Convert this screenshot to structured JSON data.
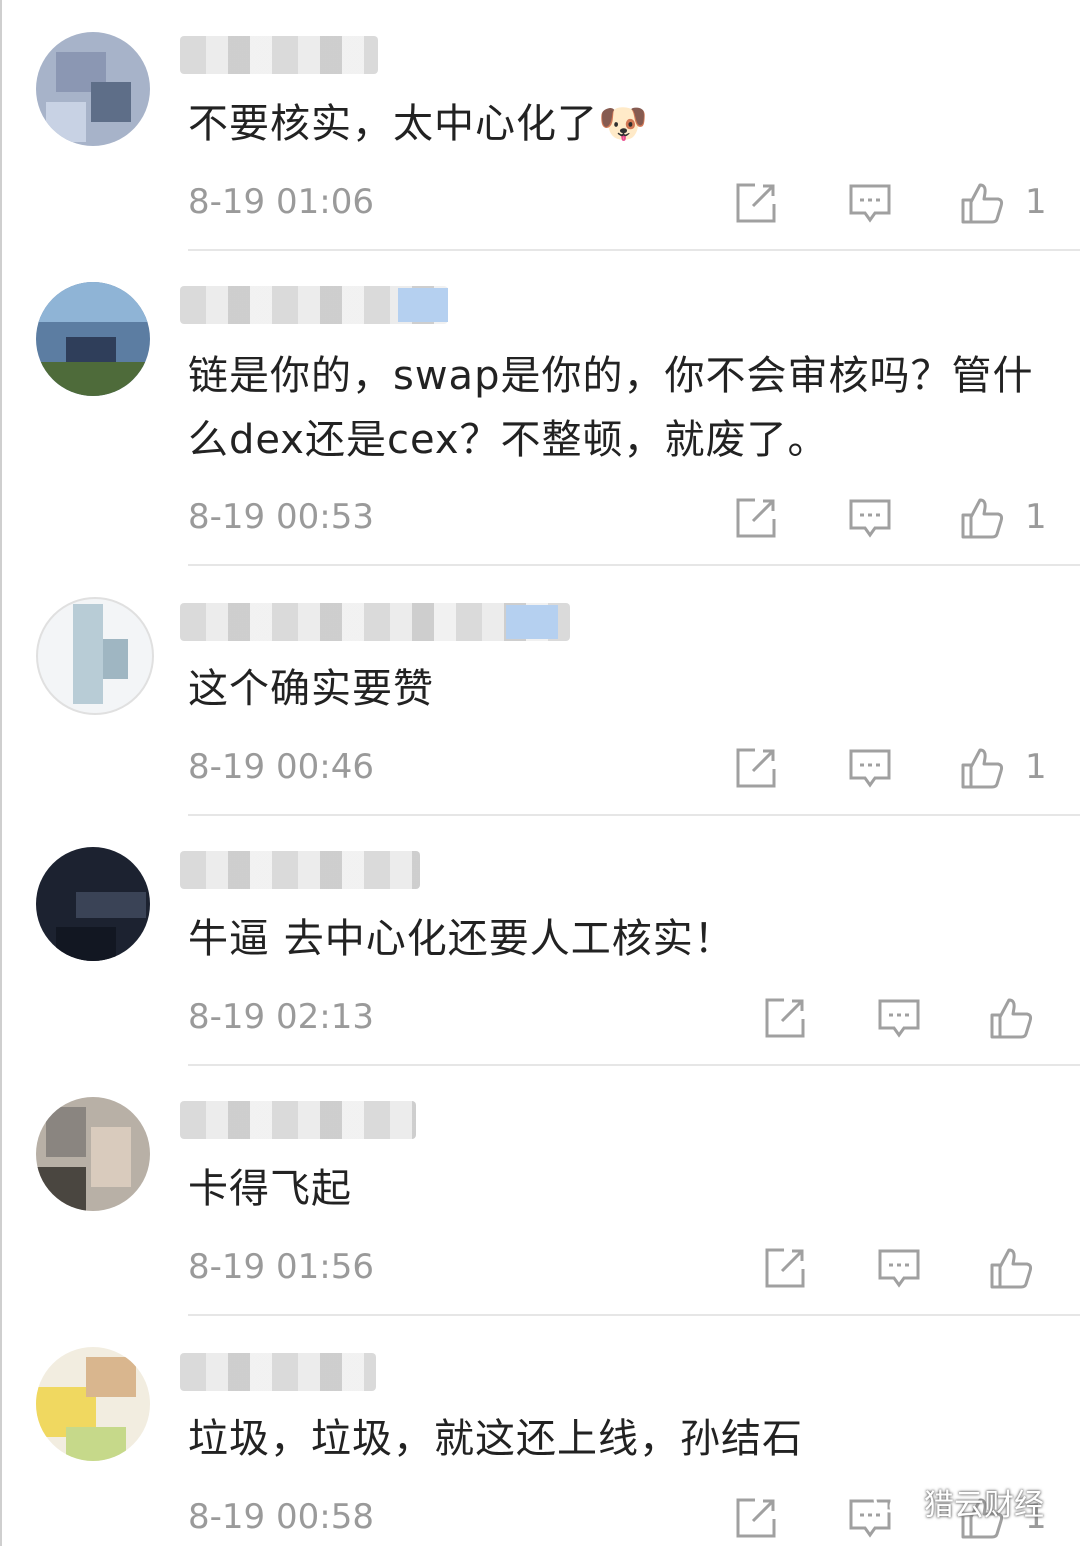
{
  "comments": [
    {
      "text": "不要核实，太中心化了",
      "emoji": "🐶",
      "time": "8-19 01:06",
      "likes": "1"
    },
    {
      "text": "链是你的，swap是你的，你不会审核吗？管什么dex还是cex？不整顿，就废了。",
      "time": "8-19 00:53",
      "likes": "1"
    },
    {
      "text": "这个确实要赞",
      "time": "8-19 00:46",
      "likes": "1"
    },
    {
      "text": "牛逼 去中心化还要人工核实！",
      "time": "8-19 02:13",
      "likes": ""
    },
    {
      "text": "卡得飞起",
      "time": "8-19 01:56",
      "likes": ""
    },
    {
      "text": "垃圾，垃圾，就这还上线，孙结石",
      "time": "8-19 00:58",
      "likes": "1"
    }
  ],
  "watermark": {
    "label": "猎云财经",
    "icon": "wechat-icon"
  },
  "colors": {
    "text": "#222222",
    "meta": "#9a9a9a",
    "divider": "#e6e6e6"
  }
}
